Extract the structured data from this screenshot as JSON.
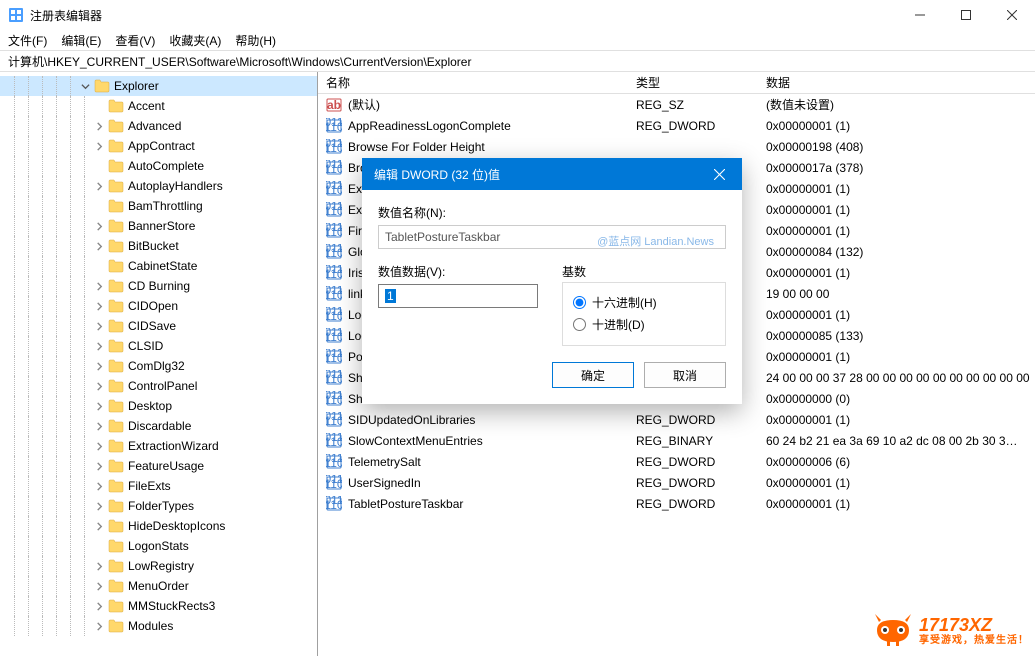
{
  "window": {
    "title": "注册表编辑器"
  },
  "menu": {
    "file": "文件(F)",
    "edit": "编辑(E)",
    "view": "查看(V)",
    "favorites": "收藏夹(A)",
    "help": "帮助(H)"
  },
  "address": "计算机\\HKEY_CURRENT_USER\\Software\\Microsoft\\Windows\\CurrentVersion\\Explorer",
  "tree": [
    {
      "depth": 5,
      "exp": "down",
      "label": "Explorer",
      "selected": true
    },
    {
      "depth": 6,
      "exp": "none",
      "label": "Accent"
    },
    {
      "depth": 6,
      "exp": "right",
      "label": "Advanced"
    },
    {
      "depth": 6,
      "exp": "right",
      "label": "AppContract"
    },
    {
      "depth": 6,
      "exp": "none",
      "label": "AutoComplete"
    },
    {
      "depth": 6,
      "exp": "right",
      "label": "AutoplayHandlers"
    },
    {
      "depth": 6,
      "exp": "none",
      "label": "BamThrottling"
    },
    {
      "depth": 6,
      "exp": "right",
      "label": "BannerStore"
    },
    {
      "depth": 6,
      "exp": "right",
      "label": "BitBucket"
    },
    {
      "depth": 6,
      "exp": "none",
      "label": "CabinetState"
    },
    {
      "depth": 6,
      "exp": "right",
      "label": "CD Burning"
    },
    {
      "depth": 6,
      "exp": "right",
      "label": "CIDOpen"
    },
    {
      "depth": 6,
      "exp": "right",
      "label": "CIDSave"
    },
    {
      "depth": 6,
      "exp": "right",
      "label": "CLSID"
    },
    {
      "depth": 6,
      "exp": "right",
      "label": "ComDlg32"
    },
    {
      "depth": 6,
      "exp": "right",
      "label": "ControlPanel"
    },
    {
      "depth": 6,
      "exp": "right",
      "label": "Desktop"
    },
    {
      "depth": 6,
      "exp": "right",
      "label": "Discardable"
    },
    {
      "depth": 6,
      "exp": "right",
      "label": "ExtractionWizard"
    },
    {
      "depth": 6,
      "exp": "right",
      "label": "FeatureUsage"
    },
    {
      "depth": 6,
      "exp": "right",
      "label": "FileExts"
    },
    {
      "depth": 6,
      "exp": "right",
      "label": "FolderTypes"
    },
    {
      "depth": 6,
      "exp": "right",
      "label": "HideDesktopIcons"
    },
    {
      "depth": 6,
      "exp": "none",
      "label": "LogonStats"
    },
    {
      "depth": 6,
      "exp": "right",
      "label": "LowRegistry"
    },
    {
      "depth": 6,
      "exp": "right",
      "label": "MenuOrder"
    },
    {
      "depth": 6,
      "exp": "right",
      "label": "MMStuckRects3"
    },
    {
      "depth": 6,
      "exp": "right",
      "label": "Modules"
    }
  ],
  "columns": {
    "name": "名称",
    "type": "类型",
    "data": "数据"
  },
  "values": [
    {
      "icon": "str",
      "name": "(默认)",
      "type": "REG_SZ",
      "data": "(数值未设置)"
    },
    {
      "icon": "bin",
      "name": "AppReadinessLogonComplete",
      "type": "REG_DWORD",
      "data": "0x00000001 (1)"
    },
    {
      "icon": "bin",
      "name": "Browse For Folder Height",
      "type": "",
      "data": "0x00000198 (408)"
    },
    {
      "icon": "bin",
      "name": "Bro",
      "type": "",
      "data": "0x0000017a (378)"
    },
    {
      "icon": "bin",
      "name": "Excl",
      "type": "",
      "data": "0x00000001 (1)"
    },
    {
      "icon": "bin",
      "name": "Exp",
      "type": "",
      "data": "0x00000001 (1)"
    },
    {
      "icon": "bin",
      "name": "Firs",
      "type": "",
      "data": "0x00000001 (1)"
    },
    {
      "icon": "bin",
      "name": "Glo",
      "type": "",
      "data": "0x00000084 (132)"
    },
    {
      "icon": "bin",
      "name": "IrisC",
      "type": "",
      "data": "0x00000001 (1)"
    },
    {
      "icon": "bin",
      "name": "link",
      "type": "",
      "data": "19 00 00 00"
    },
    {
      "icon": "bin",
      "name": "Loc",
      "type": "",
      "data": "0x00000001 (1)"
    },
    {
      "icon": "bin",
      "name": "Log",
      "type": "",
      "data": "0x00000085 (133)"
    },
    {
      "icon": "bin",
      "name": "Pos",
      "type": "",
      "data": "0x00000001 (1)"
    },
    {
      "icon": "bin",
      "name": "She",
      "type": "",
      "data": "24 00 00 00 37 28 00 00 00 00 00 00 00 00 00 00"
    },
    {
      "icon": "bin",
      "name": "Show",
      "type": "",
      "data": "0x00000000 (0)"
    },
    {
      "icon": "bin",
      "name": "SIDUpdatedOnLibraries",
      "type": "REG_DWORD",
      "data": "0x00000001 (1)"
    },
    {
      "icon": "bin",
      "name": "SlowContextMenuEntries",
      "type": "REG_BINARY",
      "data": "60 24 b2 21 ea 3a 69 10 a2 dc 08 00 2b 30 3…"
    },
    {
      "icon": "bin",
      "name": "TelemetrySalt",
      "type": "REG_DWORD",
      "data": "0x00000006 (6)"
    },
    {
      "icon": "bin",
      "name": "UserSignedIn",
      "type": "REG_DWORD",
      "data": "0x00000001 (1)"
    },
    {
      "icon": "bin",
      "name": "TabletPostureTaskbar",
      "type": "REG_DWORD",
      "data": "0x00000001 (1)"
    }
  ],
  "dialog": {
    "title": "编辑 DWORD (32 位)值",
    "name_label": "数值名称(N):",
    "name_value": "TabletPostureTaskbar",
    "data_label": "数值数据(V):",
    "data_value": "1",
    "base_label": "基数",
    "radio_hex": "十六进制(H)",
    "radio_dec": "十进制(D)",
    "ok": "确定",
    "cancel": "取消",
    "watermark": "@蓝点网 Landian.News"
  },
  "brand": {
    "main": "17173XZ",
    "sub": "享受游戏，热爱生活！"
  }
}
